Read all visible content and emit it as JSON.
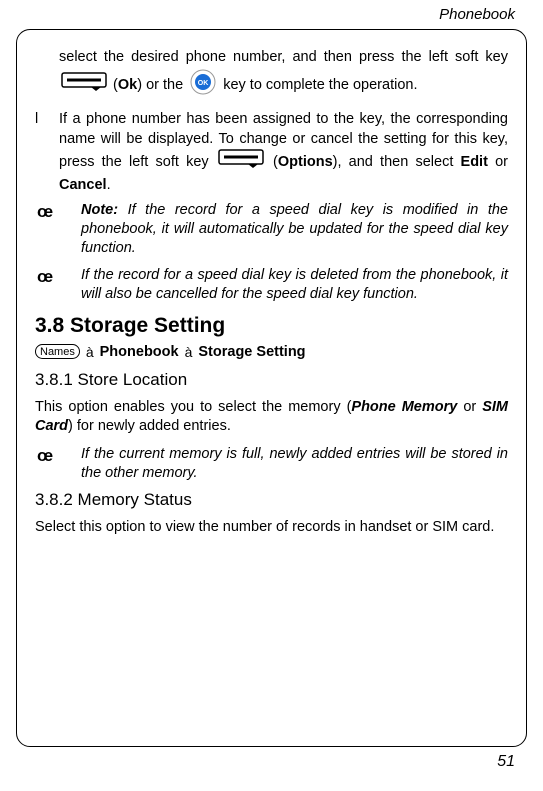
{
  "header": {
    "title": "Phonebook"
  },
  "content": {
    "para1_a": "select the desired phone number, and then press the left soft key ",
    "para1_b": " (",
    "para1_ok": "Ok",
    "para1_c": ") or the ",
    "para1_d": " key to complete the operation.",
    "bullet1_marker": "l",
    "bullet1_a": "If a phone number has been assigned to the key, the corresponding name will be displayed. To change or cancel the setting for this key, press the left soft key ",
    "bullet1_b": " (",
    "bullet1_options": "Options",
    "bullet1_c": "), and then select ",
    "bullet1_edit": "Edit",
    "bullet1_or": " or ",
    "bullet1_cancel": "Cancel",
    "bullet1_d": ".",
    "note1_marker": "œ",
    "note1_label": "Note:",
    "note1_text": " If the record for a speed dial key is modified in the phonebook, it will automatically be updated for the speed dial key function.",
    "note2_marker": "œ",
    "note2_text": "If the record for a speed dial key is deleted from the phonebook, it will also be cancelled for the speed dial key function.",
    "h2": "3.8 Storage Setting",
    "nav_names": "Names",
    "nav_arrow": "à",
    "nav_phonebook": "Phonebook",
    "nav_storage": "Storage Setting",
    "h3_1": "3.8.1 Store Location",
    "para2_a": "This option enables you to select the memory (",
    "para2_phone": "Phone Memory",
    "para2_or": " or ",
    "para2_sim": "SIM Card",
    "para2_b": ") for newly added entries.",
    "note3_marker": "œ",
    "note3_text": "If the current memory is full, newly added entries will be stored in the other memory.",
    "h3_2": "3.8.2 Memory Status",
    "para3": "Select this option to view the number of records in handset or SIM card."
  },
  "footer": {
    "page": "51"
  }
}
